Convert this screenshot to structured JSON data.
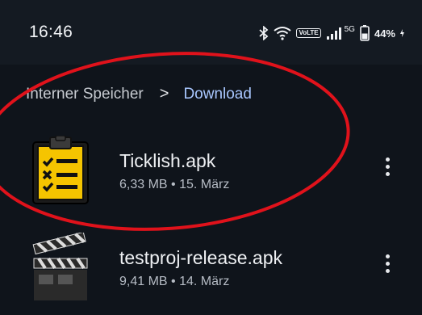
{
  "status_bar": {
    "time": "16:46",
    "lte_label": "VoLTE",
    "signal_label": "5G",
    "battery": "44%"
  },
  "breadcrumb": {
    "root": "Interner Speicher",
    "separator": ">",
    "current": "Download"
  },
  "files": [
    {
      "name": "Ticklish.apk",
      "meta": "6,33 MB • 15. März",
      "icon": "clipboard-checklist-icon"
    },
    {
      "name": "testproj-release.apk",
      "meta": "9,41 MB • 14. März",
      "icon": "clapperboard-icon"
    }
  ],
  "colors": {
    "background": "#0f141b",
    "status_bar": "#141a22",
    "accent": "#a9c7ff",
    "annotation": "#e0121b"
  }
}
